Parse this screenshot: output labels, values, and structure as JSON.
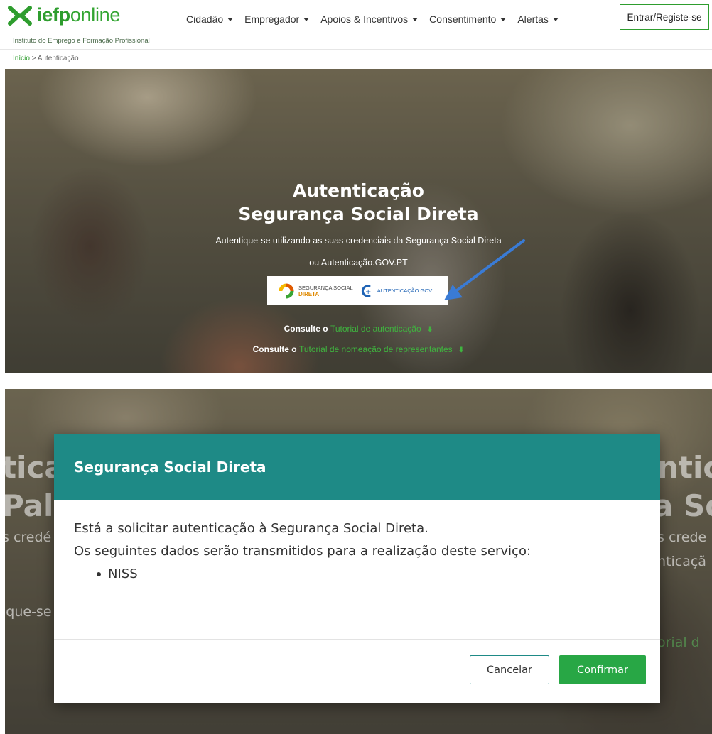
{
  "header": {
    "logo_bold": "iefp",
    "logo_light": "online",
    "logo_subtitle": "Instituto do Emprego e Formação Profissional",
    "nav": [
      {
        "label": "Cidadão"
      },
      {
        "label": "Empregador"
      },
      {
        "label": "Apoios & Incentivos"
      },
      {
        "label": "Consentimento"
      },
      {
        "label": "Alertas"
      }
    ],
    "login_label": "Entrar/Registe-se"
  },
  "breadcrumb": {
    "home": "Início",
    "separator": ">",
    "current": "Autenticação"
  },
  "hero": {
    "title_line1": "Autenticação",
    "title_line2": "Segurança Social Direta",
    "subtitle_line1": "Autentique-se utilizando as suas credenciais da Segurança Social Direta",
    "subtitle_line2": "ou Autenticação.GOV.PT",
    "ssd_label_top": "SEGURANÇA SOCIAL",
    "ssd_label_bottom": "DIRETA",
    "gov_label": "AUTENTICAÇÃO.GOV",
    "link1_prefix": "Consulte o",
    "link1_text": "Tutorial de autenticação",
    "link2_prefix": "Consulte o",
    "link2_text": "Tutorial de nomeação de representantes"
  },
  "modal": {
    "title": "Segurança Social Direta",
    "line1": "Está a solicitar autenticação à Segurança Social Direta.",
    "line2": "Os seguintes dados serão transmitidos para a realização deste serviço:",
    "items": [
      "NISS"
    ],
    "cancel_label": "Cancelar",
    "confirm_label": "Confirmar"
  },
  "background_fragments": {
    "left_big1": "tica",
    "left_big2": "Pala",
    "left_mid": "s credé",
    "left_green": "ique-se",
    "right_big1": "ntic",
    "right_big2": "a So",
    "right_mid1": "s crede",
    "right_mid2": "nticaçã",
    "right_green": "orial d"
  },
  "colors": {
    "brand_green": "#2e9d2e",
    "modal_header": "#1e8a86",
    "confirm_green": "#28a745",
    "arrow_blue": "#3a7bd5"
  }
}
